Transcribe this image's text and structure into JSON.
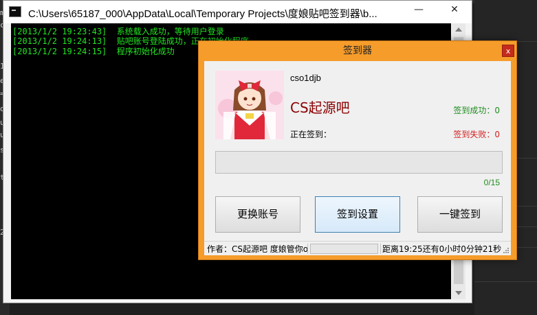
{
  "background_editor": {
    "gutter": [
      "m",
      "ch",
      "1",
      "e",
      "=",
      "ow",
      "u",
      "ut",
      "s",
      "te",
      "2"
    ]
  },
  "console": {
    "title": "C:\\Users\\65187_000\\AppData\\Local\\Temporary Projects\\度娘贴吧签到器\\b...",
    "controls": {
      "minimize": "—",
      "close": "✕"
    },
    "log": [
      "[2013/1/2 19:23:43]  系统载入成功，等待用户登录",
      "[2013/1/2 19:24:13]  贴吧账号登陆成功，正在初始化程序",
      "[2013/1/2 19:24:15]  程序初始化成功"
    ],
    "colors": {
      "text": "#22e622",
      "background": "#000000"
    }
  },
  "dialog": {
    "title": "签到器",
    "close_glyph": "x",
    "username": "cso1djb",
    "forum_name": "CS起源吧",
    "signing_label": "正在签到：",
    "success_label": "签到成功：0",
    "fail_label": "签到失败：0",
    "progress": {
      "done": 0,
      "total": 15,
      "text": "0/15"
    },
    "buttons": {
      "switch_account": "更换账号",
      "sign_settings": "签到设置",
      "one_click_sign": "一键签到"
    },
    "status": {
      "author": "作者：CS起源吧 度娘管你o",
      "timer": "距离19:25还有0小时0分钟21秒"
    },
    "accent_color": "#f59c2b"
  }
}
